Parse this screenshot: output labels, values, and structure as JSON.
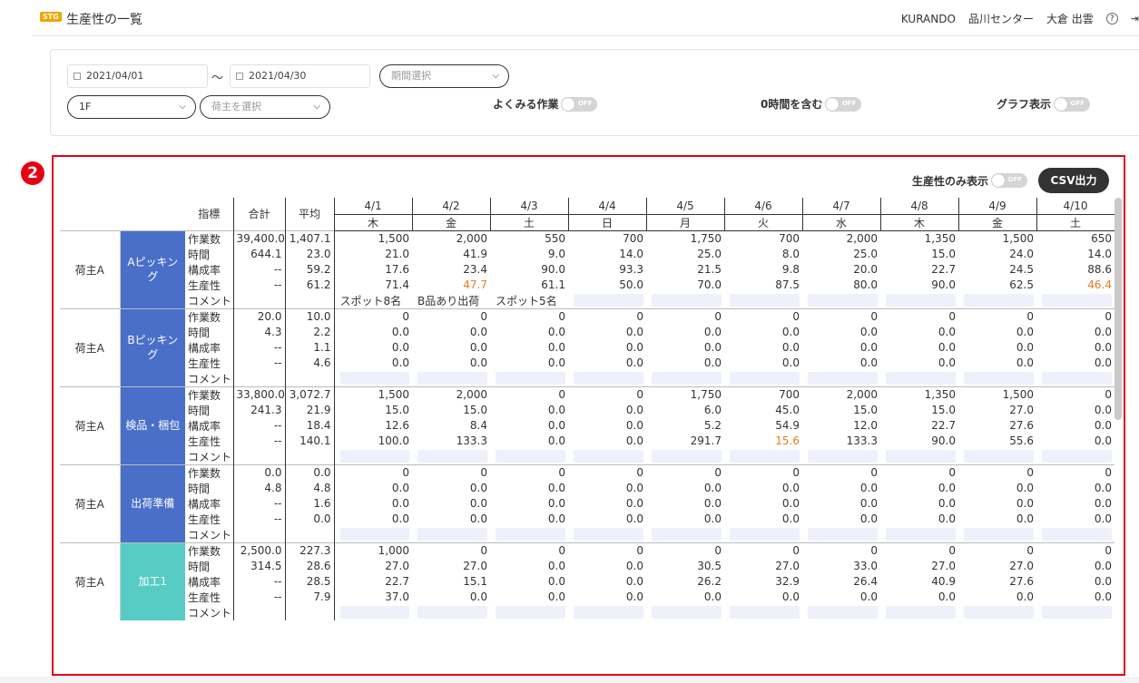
{
  "header": {
    "badge": "STG",
    "title": "生産性の一覧",
    "company": "KURANDO",
    "center": "品川センター",
    "user": "大倉 出雲",
    "help": "?",
    "logout": "⇥"
  },
  "filters": {
    "date_from": "2021/04/01",
    "tilde": "〜",
    "date_to": "2021/04/30",
    "period_placeholder": "期間選択",
    "floor": "1F",
    "owner_placeholder": "荷主を選択",
    "toggle_frequent": "よくみる作業",
    "toggle_zero": "0時間を含む",
    "toggle_graph": "グラフ表示",
    "off": "OFF"
  },
  "section": {
    "number": "2",
    "toggle_productivity_only": "生産性のみ表示",
    "off": "OFF",
    "csv_button": "CSV出力"
  },
  "table": {
    "col_metric": "指標",
    "col_total": "合計",
    "col_avg": "平均",
    "dates": [
      "4/1",
      "4/2",
      "4/3",
      "4/4",
      "4/5",
      "4/6",
      "4/7",
      "4/8",
      "4/9",
      "4/10"
    ],
    "weekdays": [
      "木",
      "金",
      "土",
      "日",
      "月",
      "火",
      "水",
      "木",
      "金",
      "土"
    ],
    "metrics": [
      "作業数",
      "時間",
      "構成率",
      "生産性",
      "コメント"
    ],
    "groups": [
      {
        "owner": "荷主A",
        "task": "Aピッキング",
        "color": "blue",
        "rows": [
          {
            "total": "39,400.0",
            "avg": "1,407.1",
            "values": [
              "1,500",
              "2,000",
              "550",
              "700",
              "1,750",
              "700",
              "2,000",
              "1,350",
              "1,500",
              "650"
            ]
          },
          {
            "total": "644.1",
            "avg": "23.0",
            "values": [
              "21.0",
              "41.9",
              "9.0",
              "14.0",
              "25.0",
              "8.0",
              "25.0",
              "15.0",
              "24.0",
              "14.0"
            ]
          },
          {
            "total": "--",
            "avg": "59.2",
            "values": [
              "17.6",
              "23.4",
              "90.0",
              "93.3",
              "21.5",
              "9.8",
              "20.0",
              "22.7",
              "24.5",
              "88.6"
            ]
          },
          {
            "total": "--",
            "avg": "61.2",
            "values": [
              "71.4",
              "47.7",
              "61.1",
              "50.0",
              "70.0",
              "87.5",
              "80.0",
              "90.0",
              "62.5",
              "46.4"
            ]
          }
        ],
        "comments": [
          "スポット8名",
          "B品あり出荷",
          "スポット5名",
          "",
          "",
          "",
          "",
          "",
          "",
          ""
        ]
      },
      {
        "owner": "荷主A",
        "task": "Bピッキング",
        "color": "blue",
        "rows": [
          {
            "total": "20.0",
            "avg": "10.0",
            "values": [
              "0",
              "0",
              "0",
              "0",
              "0",
              "0",
              "0",
              "0",
              "0",
              "0"
            ]
          },
          {
            "total": "4.3",
            "avg": "2.2",
            "values": [
              "0.0",
              "0.0",
              "0.0",
              "0.0",
              "0.0",
              "0.0",
              "0.0",
              "0.0",
              "0.0",
              "0.0"
            ]
          },
          {
            "total": "--",
            "avg": "1.1",
            "values": [
              "0.0",
              "0.0",
              "0.0",
              "0.0",
              "0.0",
              "0.0",
              "0.0",
              "0.0",
              "0.0",
              "0.0"
            ]
          },
          {
            "total": "--",
            "avg": "4.6",
            "values": [
              "0.0",
              "0.0",
              "0.0",
              "0.0",
              "0.0",
              "0.0",
              "0.0",
              "0.0",
              "0.0",
              "0.0"
            ]
          }
        ],
        "comments": [
          "",
          "",
          "",
          "",
          "",
          "",
          "",
          "",
          "",
          ""
        ]
      },
      {
        "owner": "荷主A",
        "task": "検品・梱包",
        "color": "blue",
        "rows": [
          {
            "total": "33,800.0",
            "avg": "3,072.7",
            "values": [
              "1,500",
              "2,000",
              "0",
              "0",
              "1,750",
              "700",
              "2,000",
              "1,350",
              "1,500",
              "0"
            ]
          },
          {
            "total": "241.3",
            "avg": "21.9",
            "values": [
              "15.0",
              "15.0",
              "0.0",
              "0.0",
              "6.0",
              "45.0",
              "15.0",
              "15.0",
              "27.0",
              "0.0"
            ]
          },
          {
            "total": "--",
            "avg": "18.4",
            "values": [
              "12.6",
              "8.4",
              "0.0",
              "0.0",
              "5.2",
              "54.9",
              "12.0",
              "22.7",
              "27.6",
              "0.0"
            ]
          },
          {
            "total": "--",
            "avg": "140.1",
            "values": [
              "100.0",
              "133.3",
              "0.0",
              "0.0",
              "291.7",
              "15.6",
              "133.3",
              "90.0",
              "55.6",
              "0.0"
            ]
          }
        ],
        "comments": [
          "",
          "",
          "",
          "",
          "",
          "",
          "",
          "",
          "",
          ""
        ]
      },
      {
        "owner": "荷主A",
        "task": "出荷準備",
        "color": "blue",
        "rows": [
          {
            "total": "0.0",
            "avg": "0.0",
            "values": [
              "0",
              "0",
              "0",
              "0",
              "0",
              "0",
              "0",
              "0",
              "0",
              "0"
            ]
          },
          {
            "total": "4.8",
            "avg": "4.8",
            "values": [
              "0.0",
              "0.0",
              "0.0",
              "0.0",
              "0.0",
              "0.0",
              "0.0",
              "0.0",
              "0.0",
              "0.0"
            ]
          },
          {
            "total": "--",
            "avg": "1.6",
            "values": [
              "0.0",
              "0.0",
              "0.0",
              "0.0",
              "0.0",
              "0.0",
              "0.0",
              "0.0",
              "0.0",
              "0.0"
            ]
          },
          {
            "total": "--",
            "avg": "0.0",
            "values": [
              "0.0",
              "0.0",
              "0.0",
              "0.0",
              "0.0",
              "0.0",
              "0.0",
              "0.0",
              "0.0",
              "0.0"
            ]
          }
        ],
        "comments": [
          "",
          "",
          "",
          "",
          "",
          "",
          "",
          "",
          "",
          ""
        ]
      },
      {
        "owner": "荷主A",
        "task": "加工1",
        "color": "teal",
        "rows": [
          {
            "total": "2,500.0",
            "avg": "227.3",
            "values": [
              "1,000",
              "0",
              "0",
              "0",
              "0",
              "0",
              "0",
              "0",
              "0",
              "0"
            ]
          },
          {
            "total": "314.5",
            "avg": "28.6",
            "values": [
              "27.0",
              "27.0",
              "0.0",
              "0.0",
              "30.5",
              "27.0",
              "33.0",
              "27.0",
              "27.0",
              "0.0"
            ]
          },
          {
            "total": "--",
            "avg": "28.5",
            "values": [
              "22.7",
              "15.1",
              "0.0",
              "0.0",
              "26.2",
              "32.9",
              "26.4",
              "40.9",
              "27.6",
              "0.0"
            ]
          },
          {
            "total": "--",
            "avg": "7.9",
            "values": [
              "37.0",
              "0.0",
              "0.0",
              "0.0",
              "0.0",
              "0.0",
              "0.0",
              "0.0",
              "0.0",
              "0.0"
            ]
          }
        ],
        "comments": [
          "",
          "",
          "",
          "",
          "",
          "",
          "",
          "",
          "",
          ""
        ]
      }
    ],
    "highlight_color": "#e67e22",
    "highlighted": [
      [
        0,
        3,
        1
      ],
      [
        0,
        3,
        9
      ],
      [
        2,
        3,
        5
      ]
    ]
  },
  "colors": {
    "task_blue": "#4a6fc9",
    "task_teal": "#56ccc5",
    "frame_red": "#e60012",
    "badge_orange": "#f0a500"
  }
}
